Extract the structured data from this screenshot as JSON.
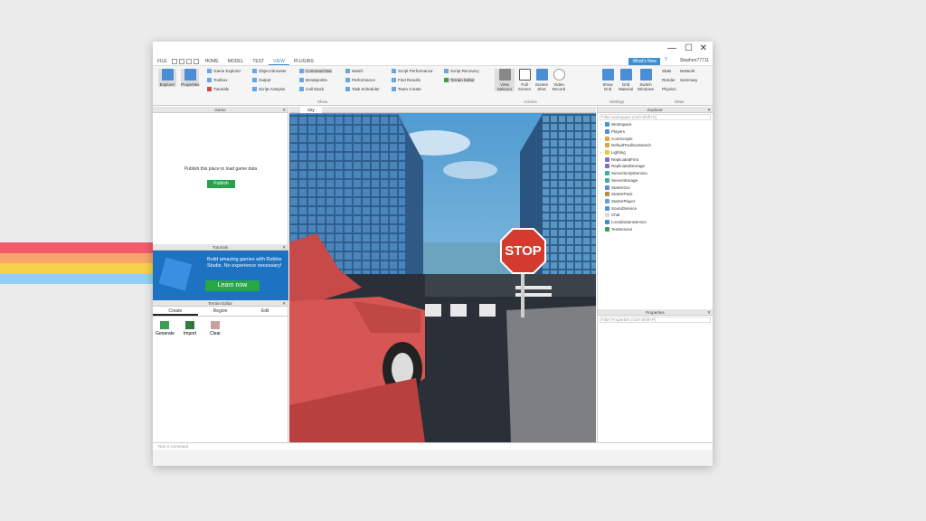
{
  "stripes": [
    "#f25c6b",
    "#f8a56b",
    "#f7d04a",
    "#8fd0f0"
  ],
  "window": {
    "controls": [
      "—",
      "☐",
      "✕"
    ]
  },
  "menubar": {
    "items": [
      "FILE",
      "HOME",
      "MODEL",
      "TEST",
      "VIEW",
      "PLUGINS"
    ],
    "active": "VIEW",
    "whats_new": "What's New",
    "user": "Stephen77711"
  },
  "ribbon": {
    "explorer": "Explorer",
    "properties": "Properties",
    "game_explorer": "Game Explorer",
    "toolbox": "Toolbox",
    "tutorials": "Tutorials",
    "object_browser": "Object Browser",
    "output": "Output",
    "script_analysis": "Script Analysis",
    "command_bar": "Command Bar",
    "breakpoints": "Breakpoints",
    "call_stack": "Call Stack",
    "watch": "Watch",
    "performance": "Performance",
    "task_scheduler": "Task Scheduler",
    "script_performance": "Script Performance",
    "find_results": "Find Results",
    "team_create": "Team Create",
    "script_recovery": "Script Recovery",
    "terrain_editor": "Terrain Editor",
    "show_label": "Show",
    "view_selector": "View Selector",
    "full_screen": "Full Screen",
    "screen_shot": "Screen Shot",
    "video_record": "Video Record",
    "actions_label": "Actions",
    "show_grid": "Show Grid",
    "grid_material": "Grid Material",
    "switch_windows": "Switch Windows",
    "settings_label": "Settings",
    "stats": "Stats",
    "network": "Network",
    "render": "Render",
    "summary": "Summary",
    "physics": "Physics",
    "stats_label": "Stats"
  },
  "game_panel": {
    "title": "Game",
    "message": "Publish this place to load game data",
    "publish": "Publish"
  },
  "tutorials_panel": {
    "title": "Tutorials",
    "headline": "Build amazing games with Roblox Studio. No experience necessary!",
    "cta": "Learn now"
  },
  "terrain_panel": {
    "title": "Terrain Editor",
    "tabs": [
      "Create",
      "Region",
      "Edit"
    ],
    "tools": [
      "Generate",
      "Import",
      "Clear"
    ]
  },
  "viewport": {
    "tab": "City",
    "sign": "STOP"
  },
  "explorer_panel": {
    "title": "Explorer",
    "filter_placeholder": "Filter workspace (Ctrl+Shift+X)",
    "items": [
      {
        "label": "Workspace",
        "color": "#3a9ad9",
        "expandable": true
      },
      {
        "label": "Players",
        "color": "#4a90e2",
        "expandable": false
      },
      {
        "label": "CoreScripts",
        "color": "#e0a23a",
        "expandable": true
      },
      {
        "label": "DefaultToolboxSearch",
        "color": "#e0a23a",
        "expandable": false
      },
      {
        "label": "Lighting",
        "color": "#f0c63a",
        "expandable": true
      },
      {
        "label": "ReplicatedFirst",
        "color": "#7b6fd6",
        "expandable": false
      },
      {
        "label": "ReplicatedStorage",
        "color": "#7b6fd6",
        "expandable": false
      },
      {
        "label": "ServerScriptService",
        "color": "#3ab0a0",
        "expandable": false
      },
      {
        "label": "ServerStorage",
        "color": "#3ab0a0",
        "expandable": false
      },
      {
        "label": "StarterGui",
        "color": "#5a8fd6",
        "expandable": false
      },
      {
        "label": "StarterPack",
        "color": "#c08a3a",
        "expandable": false
      },
      {
        "label": "StarterPlayer",
        "color": "#5aa0e0",
        "expandable": true
      },
      {
        "label": "SoundService",
        "color": "#5a8fd6",
        "expandable": false
      },
      {
        "label": "Chat",
        "color": "#dddddd",
        "expandable": false
      },
      {
        "label": "LocalizationService",
        "color": "#3a8fd6",
        "expandable": false
      },
      {
        "label": "TestService",
        "color": "#3aa050",
        "expandable": false
      }
    ]
  },
  "properties_panel": {
    "title": "Properties",
    "filter_placeholder": "Filter Properties (Ctrl+Shift+P)"
  },
  "command_bar": {
    "placeholder": "Run a command"
  }
}
